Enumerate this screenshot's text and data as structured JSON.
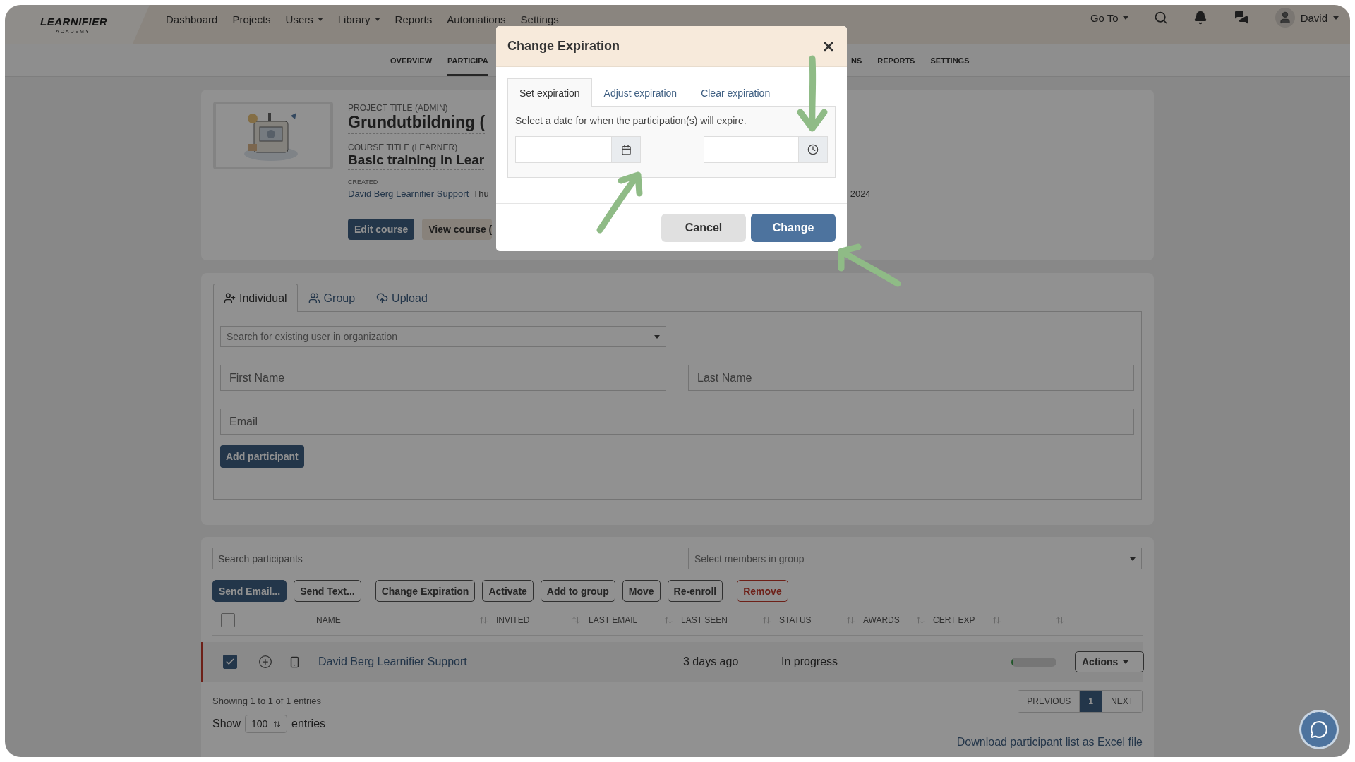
{
  "logo": {
    "name": "LEARNIFIER",
    "tagline": "ACADEMY"
  },
  "nav": {
    "items": [
      {
        "label": "Dashboard",
        "dropdown": false
      },
      {
        "label": "Projects",
        "dropdown": false
      },
      {
        "label": "Users",
        "dropdown": true
      },
      {
        "label": "Library",
        "dropdown": true
      },
      {
        "label": "Reports",
        "dropdown": false
      },
      {
        "label": "Automations",
        "dropdown": false
      },
      {
        "label": "Settings",
        "dropdown": false
      }
    ],
    "goto": "Go To",
    "user": "David"
  },
  "subnav": {
    "left": [
      {
        "label": "OVERVIEW",
        "selected": false
      },
      {
        "label": "PARTICIPA",
        "selected": true
      }
    ],
    "right": [
      {
        "label": "NS",
        "selected": false
      },
      {
        "label": "REPORTS",
        "selected": false
      },
      {
        "label": "SETTINGS",
        "selected": false
      }
    ]
  },
  "project": {
    "project_label": "PROJECT TITLE (ADMIN)",
    "project_title": "Grundutbildning (",
    "course_label": "COURSE TITLE (LEARNER)",
    "course_title": "Basic training in Lear",
    "created_label": "CREATED",
    "created_by": "David Berg Learnifier Support",
    "created_date": "Thu",
    "right_text": "2024",
    "buttons": [
      {
        "label": "Edit course",
        "kind": "primary"
      },
      {
        "label": "View course (",
        "kind": "secondary"
      }
    ]
  },
  "add_participant": {
    "tabs": [
      {
        "label": "Individual",
        "selected": true
      },
      {
        "label": "Group",
        "selected": false
      },
      {
        "label": "Upload",
        "selected": false
      }
    ],
    "search_placeholder": "Search for existing user in organization",
    "first_name_placeholder": "First Name",
    "last_name_placeholder": "Last Name",
    "email_placeholder": "Email",
    "submit": "Add participant"
  },
  "participants": {
    "search_placeholder": "Search participants",
    "group_placeholder": "Select members in group",
    "actions": [
      {
        "label": "Send Email...",
        "kind": "primary"
      },
      {
        "label": "Send Text...",
        "kind": "default"
      },
      {
        "label": "Change Expiration",
        "kind": "default"
      },
      {
        "label": "Activate",
        "kind": "default"
      },
      {
        "label": "Add to group",
        "kind": "default"
      },
      {
        "label": "Move",
        "kind": "default"
      },
      {
        "label": "Re-enroll",
        "kind": "default"
      },
      {
        "label": "Remove",
        "kind": "danger"
      }
    ],
    "select_all": {
      "checked": false
    },
    "columns": [
      {
        "label": "NAME",
        "sortable": true
      },
      {
        "label": "INVITED",
        "sortable": true
      },
      {
        "label": "LAST EMAIL",
        "sortable": true
      },
      {
        "label": "LAST SEEN",
        "sortable": true
      },
      {
        "label": "STATUS",
        "sortable": true
      },
      {
        "label": "AWARDS",
        "sortable": true
      },
      {
        "label": "CERT EXP",
        "sortable": true
      },
      {
        "sortable": true
      }
    ],
    "rows": [
      {
        "selected": true,
        "name": "David Berg Learnifier Support",
        "last_seen": "3 days ago",
        "status": "In progress",
        "progress": {
          "level": 0.05
        },
        "actions": "Actions"
      }
    ],
    "info": "Showing 1 to 1 of 1 entries",
    "pagination": [
      {
        "label": "PREVIOUS",
        "selected": false
      },
      {
        "label": "1",
        "selected": true
      },
      {
        "label": "NEXT",
        "selected": false
      }
    ],
    "show": {
      "before": "Show",
      "value": "100",
      "after": "entries"
    },
    "download": "Download participant list as Excel file"
  },
  "modal": {
    "title": "Change Expiration",
    "tabs": [
      {
        "label": "Set expiration",
        "selected": true
      },
      {
        "label": "Adjust expiration",
        "selected": false
      },
      {
        "label": "Clear expiration",
        "selected": false
      }
    ],
    "instruction": "Select a date for when the participation(s) will expire.",
    "buttons": [
      {
        "label": "Cancel",
        "kind": "secondary"
      },
      {
        "label": "Change",
        "kind": "primary"
      }
    ]
  }
}
